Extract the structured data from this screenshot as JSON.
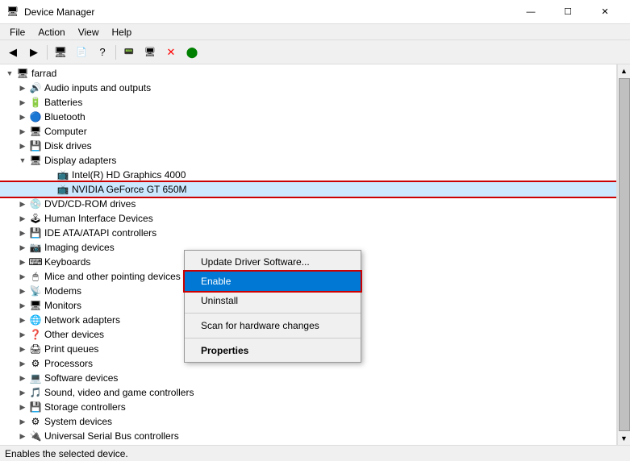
{
  "window": {
    "title": "Device Manager",
    "icon": "🖥",
    "controls": {
      "minimize": "—",
      "maximize": "☐",
      "close": "✕"
    }
  },
  "menubar": {
    "items": [
      "File",
      "Action",
      "View",
      "Help"
    ]
  },
  "toolbar": {
    "buttons": [
      "◀",
      "▶",
      "🖥",
      "📄",
      "?",
      "📟",
      "🖥",
      "❌",
      "🟢"
    ]
  },
  "tree": {
    "root": "farrad",
    "items": [
      {
        "id": "audio",
        "label": "Audio inputs and outputs",
        "indent": 1,
        "icon": "🔊",
        "expanded": false,
        "type": "category"
      },
      {
        "id": "batteries",
        "label": "Batteries",
        "indent": 1,
        "icon": "🔋",
        "expanded": false,
        "type": "category"
      },
      {
        "id": "bluetooth",
        "label": "Bluetooth",
        "indent": 1,
        "icon": "🔵",
        "expanded": false,
        "type": "category"
      },
      {
        "id": "computer",
        "label": "Computer",
        "indent": 1,
        "icon": "🖥",
        "expanded": false,
        "type": "category"
      },
      {
        "id": "diskdrives",
        "label": "Disk drives",
        "indent": 1,
        "icon": "💾",
        "expanded": false,
        "type": "category"
      },
      {
        "id": "displayadapters",
        "label": "Display adapters",
        "indent": 1,
        "icon": "🖥",
        "expanded": true,
        "type": "category"
      },
      {
        "id": "intel",
        "label": "Intel(R) HD Graphics 4000",
        "indent": 2,
        "icon": "📺",
        "expanded": false,
        "type": "device"
      },
      {
        "id": "nvidia",
        "label": "NVIDIA GeForce GT 650M",
        "indent": 2,
        "icon": "📺",
        "expanded": false,
        "type": "device",
        "selected": true,
        "context": true
      },
      {
        "id": "dvd",
        "label": "DVD/CD-ROM drives",
        "indent": 1,
        "icon": "💿",
        "expanded": false,
        "type": "category"
      },
      {
        "id": "hid",
        "label": "Human Interface Devices",
        "indent": 1,
        "icon": "🕹",
        "expanded": false,
        "type": "category"
      },
      {
        "id": "ide",
        "label": "IDE ATA/ATAPI controllers",
        "indent": 1,
        "icon": "💾",
        "expanded": false,
        "type": "category"
      },
      {
        "id": "imaging",
        "label": "Imaging devices",
        "indent": 1,
        "icon": "📷",
        "expanded": false,
        "type": "category"
      },
      {
        "id": "keyboards",
        "label": "Keyboards",
        "indent": 1,
        "icon": "⌨",
        "expanded": false,
        "type": "category"
      },
      {
        "id": "mice",
        "label": "Mice and other pointing devices",
        "indent": 1,
        "icon": "🖱",
        "expanded": false,
        "type": "category"
      },
      {
        "id": "modems",
        "label": "Modems",
        "indent": 1,
        "icon": "📡",
        "expanded": false,
        "type": "category"
      },
      {
        "id": "monitors",
        "label": "Monitors",
        "indent": 1,
        "icon": "🖥",
        "expanded": false,
        "type": "category"
      },
      {
        "id": "network",
        "label": "Network adapters",
        "indent": 1,
        "icon": "🌐",
        "expanded": false,
        "type": "category"
      },
      {
        "id": "other",
        "label": "Other devices",
        "indent": 1,
        "icon": "❓",
        "expanded": false,
        "type": "category"
      },
      {
        "id": "print",
        "label": "Print queues",
        "indent": 1,
        "icon": "🖨",
        "expanded": false,
        "type": "category"
      },
      {
        "id": "processors",
        "label": "Processors",
        "indent": 1,
        "icon": "⚙",
        "expanded": false,
        "type": "category"
      },
      {
        "id": "software",
        "label": "Software devices",
        "indent": 1,
        "icon": "💻",
        "expanded": false,
        "type": "category"
      },
      {
        "id": "sound",
        "label": "Sound, video and game controllers",
        "indent": 1,
        "icon": "🎵",
        "expanded": false,
        "type": "category"
      },
      {
        "id": "storage",
        "label": "Storage controllers",
        "indent": 1,
        "icon": "💾",
        "expanded": false,
        "type": "category"
      },
      {
        "id": "system",
        "label": "System devices",
        "indent": 1,
        "icon": "⚙",
        "expanded": false,
        "type": "category"
      },
      {
        "id": "usb",
        "label": "Universal Serial Bus controllers",
        "indent": 1,
        "icon": "🔌",
        "expanded": false,
        "type": "category"
      }
    ]
  },
  "context_menu": {
    "items": [
      {
        "id": "update",
        "label": "Update Driver Software...",
        "type": "normal"
      },
      {
        "id": "enable",
        "label": "Enable",
        "type": "active"
      },
      {
        "id": "uninstall",
        "label": "Uninstall",
        "type": "normal"
      },
      {
        "id": "sep1",
        "type": "separator"
      },
      {
        "id": "scan",
        "label": "Scan for hardware changes",
        "type": "normal"
      },
      {
        "id": "sep2",
        "type": "separator"
      },
      {
        "id": "properties",
        "label": "Properties",
        "type": "bold"
      }
    ]
  },
  "status_bar": {
    "text": "Enables the selected device."
  }
}
